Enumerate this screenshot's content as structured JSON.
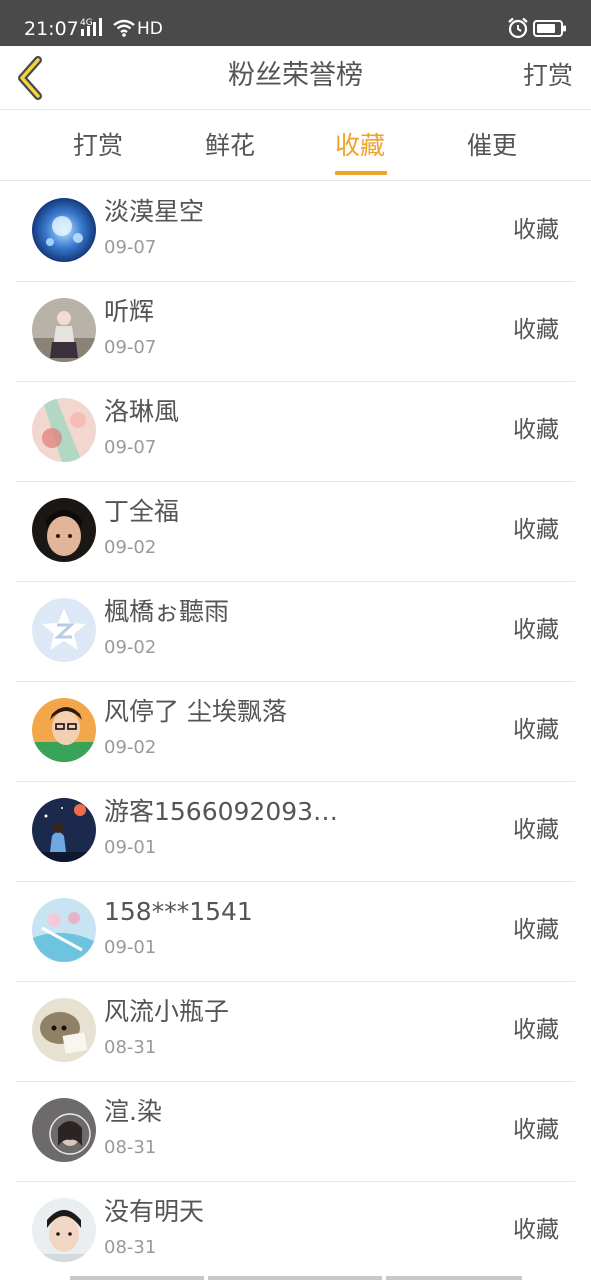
{
  "status_bar": {
    "time": "21:07",
    "network": "4G",
    "hd": "HD",
    "icons": [
      "signal-icon",
      "wifi-icon",
      "alarm-icon",
      "battery-icon"
    ]
  },
  "header": {
    "title": "粉丝荣誉榜",
    "action": "打赏",
    "back_icon": "chevron-left-icon"
  },
  "tabs": [
    {
      "label": "打赏",
      "active": false
    },
    {
      "label": "鲜花",
      "active": false
    },
    {
      "label": "收藏",
      "active": true
    },
    {
      "label": "催更",
      "active": false
    }
  ],
  "accent_color": "#f0a32a",
  "fans": [
    {
      "name": "淡漠星空",
      "date": "09-07",
      "action": "收藏"
    },
    {
      "name": "听辉",
      "date": "09-07",
      "action": "收藏"
    },
    {
      "name": "洛琳風",
      "date": "09-07",
      "action": "收藏"
    },
    {
      "name": "丁全福",
      "date": "09-02",
      "action": "收藏"
    },
    {
      "name": "楓橋ぉ聽雨",
      "date": "09-02",
      "action": "收藏"
    },
    {
      "name": "风停了 尘埃飘落",
      "date": "09-02",
      "action": "收藏"
    },
    {
      "name": "游客1566092093…",
      "date": "09-01",
      "action": "收藏"
    },
    {
      "name": "158***1541",
      "date": "09-01",
      "action": "收藏"
    },
    {
      "name": "风流小瓶子",
      "date": "08-31",
      "action": "收藏"
    },
    {
      "name": "渲.染",
      "date": "08-31",
      "action": "收藏"
    },
    {
      "name": "没有明天",
      "date": "08-31",
      "action": "收藏"
    }
  ]
}
